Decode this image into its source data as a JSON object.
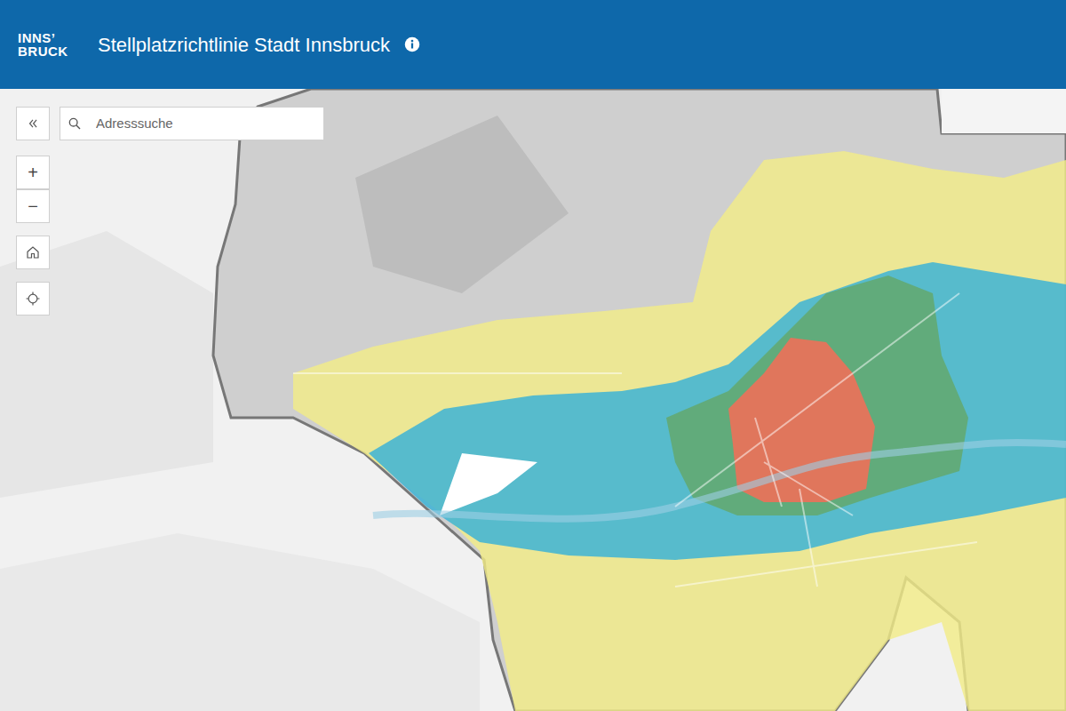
{
  "header": {
    "logo": [
      "INNS’",
      "BRUCK"
    ],
    "title": "Stellplatzrichtlinie Stadt Innsbruck"
  },
  "search": {
    "placeholder": "Adresssuche"
  },
  "zoom": [
    {
      "label": "+"
    },
    {
      "label": "−"
    }
  ],
  "zones": [
    {
      "name": "gelb",
      "color": "#f3ec86"
    },
    {
      "name": "blau",
      "color": "#3db3d6"
    },
    {
      "name": "grün",
      "color": "#63a86c"
    },
    {
      "name": "rot",
      "color": "#ee7059"
    },
    {
      "name": "weiß",
      "color": "#ffffff"
    }
  ]
}
